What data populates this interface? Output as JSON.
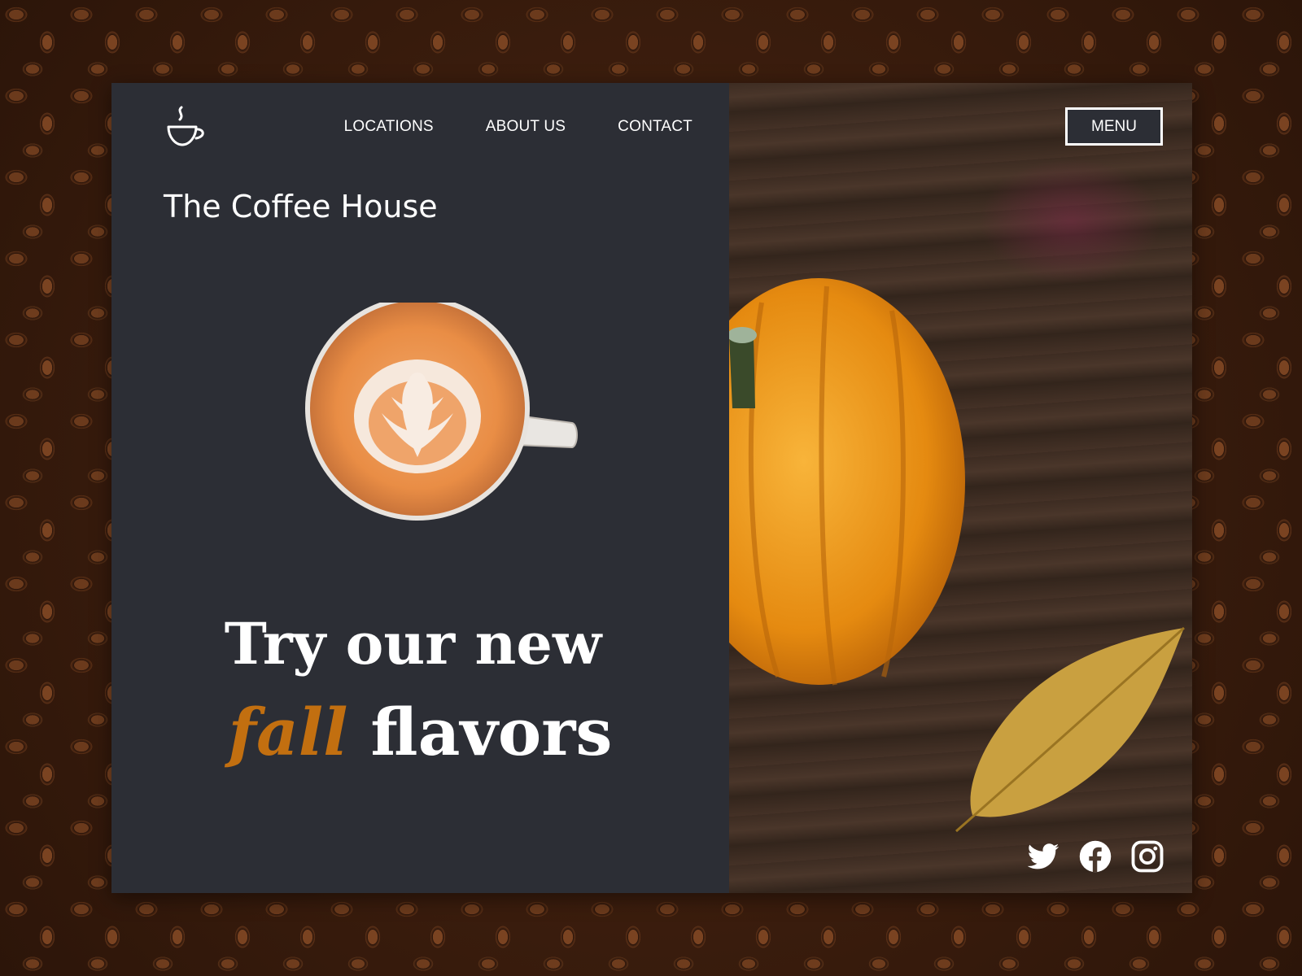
{
  "nav": {
    "items": [
      {
        "label": "LOCATIONS"
      },
      {
        "label": "ABOUT US"
      },
      {
        "label": "CONTACT"
      }
    ]
  },
  "brand": {
    "title": "The Coffee House",
    "logo_icon": "coffee-cup-icon"
  },
  "hero": {
    "line1": "Try our new",
    "accent_word": "fall",
    "line2_rest": "flavors",
    "accent_color": "#c26f10",
    "cup_image": "latte-art-coffee-cup"
  },
  "menu": {
    "label": "MENU"
  },
  "photo": {
    "subject": "pumpkin-and-leaf-on-wood"
  },
  "social": {
    "icons": [
      "twitter-icon",
      "facebook-icon",
      "instagram-icon"
    ]
  },
  "colors": {
    "panel": "#2c2e35",
    "text": "#ffffff",
    "accent": "#c26f10"
  }
}
